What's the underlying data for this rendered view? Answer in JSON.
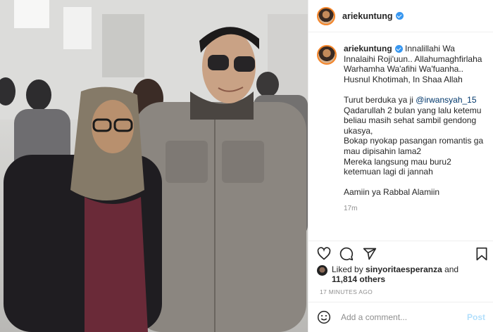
{
  "post": {
    "username": "ariekuntung",
    "photo_alt": "Photo of a man in sunglasses and a woman in a hijab",
    "caption": {
      "username": "ariekuntung",
      "line1": "Innalillahi Wa Innalaihi Roji'uun.. Allahumaghfirlaha Warhamha Wa'afihi Wa'fuanha.. Husnul Khotimah, In Shaa Allah",
      "para2_prefix": "Turut berduka ya ji ",
      "mention": "@irwansyah_15",
      "para2_suffix": " Qadarullah 2 bulan yang lalu ketemu beliau masih sehat sambil gendong ukasya,\nBokap nyokap pasangan romantis ga mau dipisahin lama2\nMereka langsung mau buru2 ketemuan lagi di jannah",
      "para3": "Aamiin ya Rabbal Alamiin",
      "time": "17m"
    },
    "likes": {
      "prefix": "Liked by ",
      "user": "sinyoritaesperanza",
      "mid": " and",
      "count": "11,814 others"
    },
    "timestamp": "17 MINUTES AGO",
    "comment": {
      "placeholder": "Add a comment...",
      "post_label": "Post"
    }
  },
  "icons": [
    "heart-icon",
    "comment-icon",
    "share-icon",
    "bookmark-icon",
    "emoji-icon",
    "verified-icon"
  ],
  "colors": {
    "verified": "#3897f0",
    "link": "#00376b",
    "post_btn": "#b2dffc"
  }
}
